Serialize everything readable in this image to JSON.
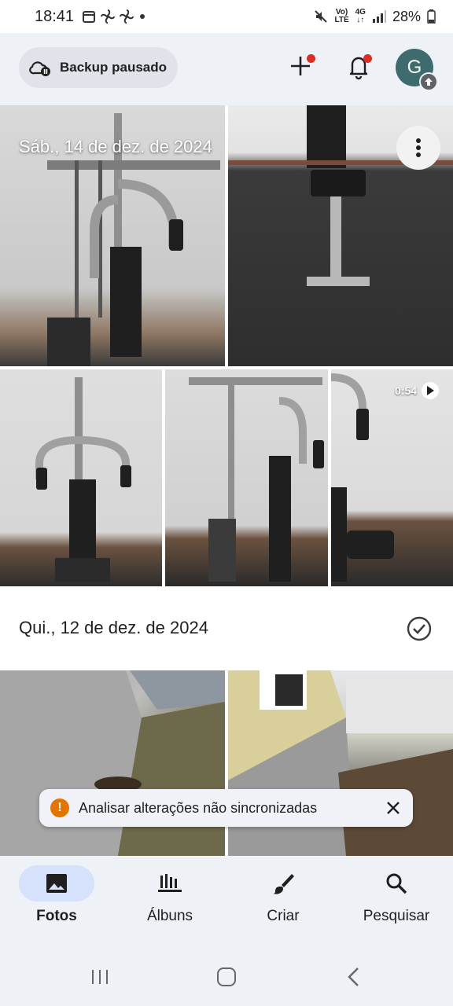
{
  "status_bar": {
    "time": "18:41",
    "network_top": "Vo)",
    "network_bottom": "LTE",
    "gen_top": "4G",
    "battery": "28%"
  },
  "top_bar": {
    "backup_label": "Backup pausado",
    "avatar_letter": "G",
    "accent_color": "#d93025"
  },
  "sections": [
    {
      "date": "Sáb., 14 de dez. de 2024",
      "video_duration": "0:54"
    },
    {
      "date": "Qui., 12 de dez. de 2024"
    }
  ],
  "snackbar": {
    "message": "Analisar alterações não sincronizadas"
  },
  "bottom_nav": [
    {
      "label": "Fotos",
      "icon": "photo-icon",
      "active": true
    },
    {
      "label": "Álbuns",
      "icon": "albums-icon",
      "active": false
    },
    {
      "label": "Criar",
      "icon": "brush-icon",
      "active": false
    },
    {
      "label": "Pesquisar",
      "icon": "search-icon",
      "active": false
    }
  ]
}
